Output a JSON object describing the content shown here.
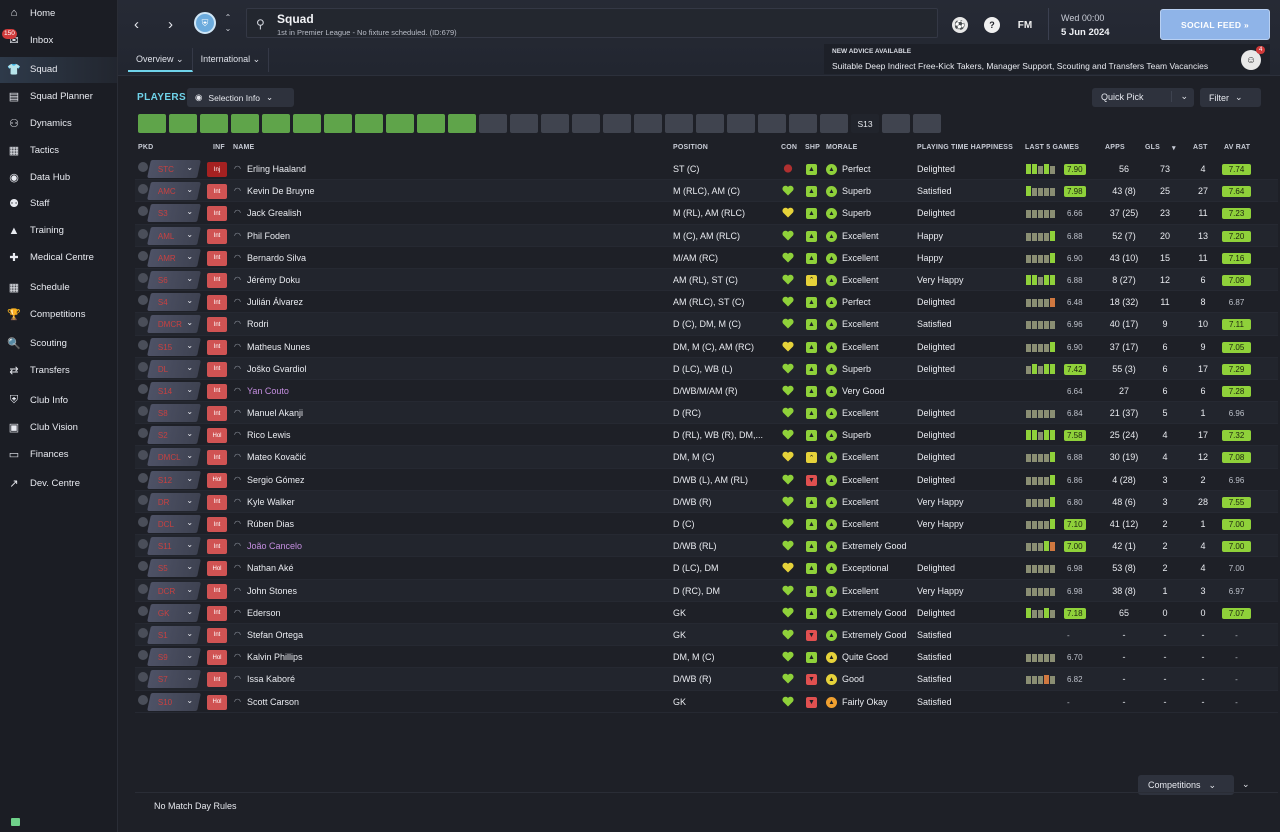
{
  "sidebar": {
    "items": [
      {
        "label": "Home",
        "icon": "home-icon",
        "glyph": "⌂"
      },
      {
        "label": "Inbox",
        "icon": "inbox-icon",
        "glyph": "✉",
        "badge": "150"
      },
      {
        "label": "Squad",
        "icon": "shirt-icon",
        "glyph": "👕",
        "active": true
      },
      {
        "label": "Squad Planner",
        "icon": "clipboard-icon",
        "glyph": "▤"
      },
      {
        "label": "Dynamics",
        "icon": "dynamics-icon",
        "glyph": "⚇"
      },
      {
        "label": "Tactics",
        "icon": "tactics-icon",
        "glyph": "▦"
      },
      {
        "label": "Data Hub",
        "icon": "data-hub-icon",
        "glyph": "◉"
      },
      {
        "label": "Staff",
        "icon": "staff-icon",
        "glyph": "⚉"
      },
      {
        "label": "Training",
        "icon": "training-icon",
        "glyph": "▲"
      },
      {
        "label": "Medical Centre",
        "icon": "medical-icon",
        "glyph": "✚"
      },
      {
        "label": "Schedule",
        "icon": "calendar-icon",
        "glyph": "▦"
      },
      {
        "label": "Competitions",
        "icon": "trophy-icon",
        "glyph": "🏆"
      },
      {
        "label": "Scouting",
        "icon": "magnifier-icon",
        "glyph": "🔍"
      },
      {
        "label": "Transfers",
        "icon": "transfers-icon",
        "glyph": "⇄"
      },
      {
        "label": "Club Info",
        "icon": "shield-icon",
        "glyph": "⛨"
      },
      {
        "label": "Club Vision",
        "icon": "briefcase-icon",
        "glyph": "▣"
      },
      {
        "label": "Finances",
        "icon": "finances-icon",
        "glyph": "▭"
      },
      {
        "label": "Dev. Centre",
        "icon": "dev-centre-icon",
        "glyph": "↗"
      }
    ]
  },
  "header": {
    "title": "Squad",
    "subtitle": "1st in Premier League - No fixture scheduled. (ID:679)",
    "fm_label": "FM",
    "help_label": "?",
    "date_top": "Wed 00:00",
    "date_bottom": "5 Jun 2024",
    "social_label": "SOCIAL FEED  »"
  },
  "tabs": [
    {
      "label": "Overview ⌄"
    },
    {
      "label": "International ⌄"
    }
  ],
  "advice": {
    "heading": "NEW ADVICE AVAILABLE",
    "text": "Suitable Deep Indirect Free-Kick Takers, Manager Support, Scouting and Transfers Team Vacancies",
    "badge": "4"
  },
  "toolbar": {
    "players_label": "PLAYERS",
    "selection_label": "Selection Info",
    "quick_pick_label": "Quick Pick",
    "filter_label": "Filter"
  },
  "position_chips": [
    {
      "label": "GK",
      "state": "g"
    },
    {
      "label": "DR",
      "state": "g"
    },
    {
      "label": "DCR",
      "state": "g"
    },
    {
      "label": "DCL",
      "state": "g"
    },
    {
      "label": "DL",
      "state": "g"
    },
    {
      "label": "DMCR",
      "state": "g"
    },
    {
      "label": "DMCL",
      "state": "g"
    },
    {
      "label": "AMR",
      "state": "g"
    },
    {
      "label": "AMC",
      "state": "g"
    },
    {
      "label": "AML",
      "state": "g"
    },
    {
      "label": "STC",
      "state": "g"
    },
    {
      "label": "S1",
      "state": "x"
    },
    {
      "label": "S2",
      "state": "x"
    },
    {
      "label": "S3",
      "state": "x"
    },
    {
      "label": "S4",
      "state": "x"
    },
    {
      "label": "S5",
      "state": "x"
    },
    {
      "label": "S6",
      "state": "x"
    },
    {
      "label": "S7",
      "state": "x"
    },
    {
      "label": "S8",
      "state": "x"
    },
    {
      "label": "S9",
      "state": "x"
    },
    {
      "label": "S10",
      "state": "x"
    },
    {
      "label": "S11",
      "state": "x"
    },
    {
      "label": "S12",
      "state": "x"
    },
    {
      "label": "S13",
      "state": "s"
    },
    {
      "label": "S14",
      "state": "x"
    },
    {
      "label": "S15",
      "state": "x"
    }
  ],
  "columns": {
    "pkd": "PKD",
    "inf": "INF",
    "name": "NAME",
    "position": "POSITION",
    "con": "CON",
    "shp": "SHP",
    "morale": "MORALE",
    "pth": "PLAYING TIME HAPPINESS",
    "last5": "LAST 5 GAMES",
    "apps": "APPS",
    "gls": "GLS",
    "gls_sort": "▾",
    "ast": "AST",
    "avrat": "AV RAT"
  },
  "players": [
    {
      "role": "STC",
      "inf": "Inj",
      "name": "Erling Haaland",
      "position": "ST (C)",
      "con": "red",
      "shp": "green",
      "morale": "Perfect",
      "mic": "green",
      "pth": "Delighted",
      "last5": [
        "g",
        "g",
        "y",
        "g",
        "y"
      ],
      "lr": "7.90",
      "lrhl": true,
      "apps": "56",
      "gls": "73",
      "ast": "4",
      "avr": "7.74",
      "avrhl": true
    },
    {
      "role": "AMC",
      "inf": "Int",
      "name": "Kevin De Bruyne",
      "position": "M (RLC), AM (C)",
      "con": "green",
      "shp": "green",
      "morale": "Superb",
      "mic": "green",
      "pth": "Satisfied",
      "last5": [
        "g",
        "y",
        "y",
        "y",
        "y"
      ],
      "lr": "7.98",
      "lrhl": true,
      "apps": "43 (8)",
      "gls": "25",
      "ast": "27",
      "avr": "7.64",
      "avrhl": true
    },
    {
      "role": "S3",
      "inf": "Int",
      "name": "Jack Grealish",
      "position": "M (RL), AM (RLC)",
      "con": "yellow",
      "shp": "green",
      "morale": "Superb",
      "mic": "green",
      "pth": "Delighted",
      "last5": [
        "y",
        "y",
        "y",
        "y",
        "y"
      ],
      "lr": "6.66",
      "lrhl": false,
      "apps": "37 (25)",
      "gls": "23",
      "ast": "11",
      "avr": "7.23",
      "avrhl": true
    },
    {
      "role": "AML",
      "inf": "Int",
      "name": "Phil Foden",
      "position": "M (C), AM (RLC)",
      "con": "green",
      "shp": "green",
      "morale": "Excellent",
      "mic": "green",
      "pth": "Happy",
      "last5": [
        "y",
        "y",
        "y",
        "y",
        "g"
      ],
      "lr": "6.88",
      "lrhl": false,
      "apps": "52 (7)",
      "gls": "20",
      "ast": "13",
      "avr": "7.20",
      "avrhl": true
    },
    {
      "role": "AMR",
      "inf": "Int",
      "name": "Bernardo Silva",
      "position": "M/AM (RC)",
      "con": "green",
      "shp": "green",
      "morale": "Excellent",
      "mic": "green",
      "pth": "Happy",
      "last5": [
        "y",
        "y",
        "y",
        "y",
        "g"
      ],
      "lr": "6.90",
      "lrhl": false,
      "apps": "43 (10)",
      "gls": "15",
      "ast": "11",
      "avr": "7.16",
      "avrhl": true
    },
    {
      "role": "S6",
      "inf": "Int",
      "name": "Jérémy Doku",
      "position": "AM (RL), ST (C)",
      "con": "green",
      "shp": "yellow",
      "morale": "Excellent",
      "mic": "green",
      "pth": "Very Happy",
      "last5": [
        "g",
        "g",
        "y",
        "g",
        "g"
      ],
      "lr": "6.88",
      "lrhl": false,
      "apps": "8 (27)",
      "gls": "12",
      "ast": "6",
      "avr": "7.08",
      "avrhl": true
    },
    {
      "role": "S4",
      "inf": "Int",
      "name": "Julián Álvarez",
      "position": "AM (RLC), ST (C)",
      "con": "green",
      "shp": "green",
      "morale": "Perfect",
      "mic": "green",
      "pth": "Delighted",
      "last5": [
        "y",
        "y",
        "y",
        "y",
        "o"
      ],
      "lr": "6.48",
      "lrhl": false,
      "apps": "18 (32)",
      "gls": "11",
      "ast": "8",
      "avr": "6.87",
      "avrhl": false
    },
    {
      "role": "DMCR",
      "inf": "Int",
      "name": "Rodri",
      "position": "D (C), DM, M (C)",
      "con": "green",
      "shp": "green",
      "morale": "Excellent",
      "mic": "green",
      "pth": "Satisfied",
      "last5": [
        "y",
        "y",
        "y",
        "y",
        "y"
      ],
      "lr": "6.96",
      "lrhl": false,
      "apps": "40 (17)",
      "gls": "9",
      "ast": "10",
      "avr": "7.11",
      "avrhl": true
    },
    {
      "role": "S15",
      "inf": "Int",
      "name": "Matheus Nunes",
      "position": "DM, M (C), AM (RC)",
      "con": "yellow",
      "shp": "green",
      "morale": "Excellent",
      "mic": "green",
      "pth": "Delighted",
      "last5": [
        "y",
        "y",
        "y",
        "y",
        "g"
      ],
      "lr": "6.90",
      "lrhl": false,
      "apps": "37 (17)",
      "gls": "6",
      "ast": "9",
      "avr": "7.05",
      "avrhl": true
    },
    {
      "role": "DL",
      "inf": "Int",
      "name": "Joško Gvardiol",
      "position": "D (LC), WB (L)",
      "con": "green",
      "shp": "green",
      "morale": "Superb",
      "mic": "green",
      "pth": "Delighted",
      "last5": [
        "y",
        "g",
        "y",
        "g",
        "g"
      ],
      "lr": "7.42",
      "lrhl": true,
      "apps": "55 (3)",
      "gls": "6",
      "ast": "17",
      "avr": "7.29",
      "avrhl": true
    },
    {
      "role": "S14",
      "inf": "Int",
      "name": "Yan Couto",
      "loan": true,
      "position": "D/WB/M/AM (R)",
      "con": "green",
      "shp": "green",
      "morale": "Very Good",
      "mic": "green",
      "pth": "",
      "last5": [],
      "lr": "6.64",
      "lrhl": false,
      "apps": "27",
      "gls": "6",
      "ast": "6",
      "avr": "7.28",
      "avrhl": true
    },
    {
      "role": "S8",
      "inf": "Int",
      "name": "Manuel Akanji",
      "position": "D (RC)",
      "con": "green",
      "shp": "green",
      "morale": "Excellent",
      "mic": "green",
      "pth": "Delighted",
      "last5": [
        "y",
        "y",
        "y",
        "y",
        "y"
      ],
      "lr": "6.84",
      "lrhl": false,
      "apps": "21 (37)",
      "gls": "5",
      "ast": "1",
      "avr": "6.96",
      "avrhl": false
    },
    {
      "role": "S2",
      "inf": "Hol",
      "name": "Rico Lewis",
      "position": "D (RL), WB (R), DM,...",
      "con": "green",
      "shp": "green",
      "morale": "Superb",
      "mic": "green",
      "pth": "Delighted",
      "last5": [
        "g",
        "g",
        "y",
        "g",
        "g"
      ],
      "lr": "7.58",
      "lrhl": true,
      "apps": "25 (24)",
      "gls": "4",
      "ast": "17",
      "avr": "7.32",
      "avrhl": true
    },
    {
      "role": "DMCL",
      "inf": "Int",
      "name": "Mateo Kovačić",
      "position": "DM, M (C)",
      "con": "yellow",
      "shp": "yellow",
      "morale": "Excellent",
      "mic": "green",
      "pth": "Delighted",
      "last5": [
        "y",
        "y",
        "y",
        "y",
        "g"
      ],
      "lr": "6.88",
      "lrhl": false,
      "apps": "30 (19)",
      "gls": "4",
      "ast": "12",
      "avr": "7.08",
      "avrhl": true
    },
    {
      "role": "S12",
      "inf": "Hol",
      "name": "Sergio Gómez",
      "position": "D/WB (L), AM (RL)",
      "con": "green",
      "shp": "red",
      "morale": "Excellent",
      "mic": "green",
      "pth": "Delighted",
      "last5": [
        "y",
        "y",
        "y",
        "y",
        "g"
      ],
      "lr": "6.86",
      "lrhl": false,
      "apps": "4 (28)",
      "gls": "3",
      "ast": "2",
      "avr": "6.96",
      "avrhl": false
    },
    {
      "role": "DR",
      "inf": "Int",
      "name": "Kyle Walker",
      "position": "D/WB (R)",
      "con": "green",
      "shp": "green",
      "morale": "Excellent",
      "mic": "green",
      "pth": "Very Happy",
      "last5": [
        "y",
        "y",
        "y",
        "y",
        "g"
      ],
      "lr": "6.80",
      "lrhl": false,
      "apps": "48 (6)",
      "gls": "3",
      "ast": "28",
      "avr": "7.55",
      "avrhl": true
    },
    {
      "role": "DCL",
      "inf": "Int",
      "name": "Rúben Dias",
      "position": "D (C)",
      "con": "green",
      "shp": "green",
      "morale": "Excellent",
      "mic": "green",
      "pth": "Very Happy",
      "last5": [
        "y",
        "y",
        "y",
        "y",
        "g"
      ],
      "lr": "7.10",
      "lrhl": true,
      "apps": "41 (12)",
      "gls": "2",
      "ast": "1",
      "avr": "7.00",
      "avrhl": true
    },
    {
      "role": "S11",
      "inf": "Int",
      "name": "João Cancelo",
      "loan": true,
      "position": "D/WB (RL)",
      "con": "green",
      "shp": "green",
      "morale": "Extremely Good",
      "mic": "green",
      "pth": "",
      "last5": [
        "y",
        "y",
        "y",
        "g",
        "o"
      ],
      "lr": "7.00",
      "lrhl": true,
      "apps": "42 (1)",
      "gls": "2",
      "ast": "4",
      "avr": "7.00",
      "avrhl": true
    },
    {
      "role": "S5",
      "inf": "Hol",
      "name": "Nathan Aké",
      "position": "D (LC), DM",
      "con": "yellow",
      "shp": "green",
      "morale": "Exceptional",
      "mic": "green",
      "pth": "Delighted",
      "last5": [
        "y",
        "y",
        "y",
        "y",
        "y"
      ],
      "lr": "6.98",
      "lrhl": false,
      "apps": "53 (8)",
      "gls": "2",
      "ast": "4",
      "avr": "7.00",
      "avrhl": false
    },
    {
      "role": "DCR",
      "inf": "Int",
      "name": "John Stones",
      "position": "D (RC), DM",
      "con": "green",
      "shp": "green",
      "morale": "Excellent",
      "mic": "green",
      "pth": "Very Happy",
      "last5": [
        "y",
        "y",
        "y",
        "y",
        "y"
      ],
      "lr": "6.98",
      "lrhl": false,
      "apps": "38 (8)",
      "gls": "1",
      "ast": "3",
      "avr": "6.97",
      "avrhl": false
    },
    {
      "role": "GK",
      "inf": "Int",
      "name": "Ederson",
      "position": "GK",
      "con": "green",
      "shp": "green",
      "morale": "Extremely Good",
      "mic": "green",
      "pth": "Delighted",
      "last5": [
        "g",
        "y",
        "y",
        "g",
        "y"
      ],
      "lr": "7.18",
      "lrhl": true,
      "apps": "65",
      "gls": "0",
      "ast": "0",
      "avr": "7.07",
      "avrhl": true
    },
    {
      "role": "S1",
      "inf": "Int",
      "name": "Stefan Ortega",
      "position": "GK",
      "con": "green",
      "shp": "red",
      "morale": "Extremely Good",
      "mic": "green",
      "pth": "Satisfied",
      "last5": [],
      "lr": "-",
      "lrhl": false,
      "apps": "-",
      "gls": "-",
      "ast": "-",
      "avr": "-",
      "avrhl": false
    },
    {
      "role": "S9",
      "inf": "Hol",
      "name": "Kalvin Phillips",
      "position": "DM, M (C)",
      "con": "green",
      "shp": "green",
      "morale": "Quite Good",
      "mic": "yellow",
      "pth": "Satisfied",
      "last5": [
        "y",
        "y",
        "y",
        "y",
        "y"
      ],
      "lr": "6.70",
      "lrhl": false,
      "apps": "-",
      "gls": "-",
      "ast": "-",
      "avr": "-",
      "avrhl": false
    },
    {
      "role": "S7",
      "inf": "Int",
      "name": "Issa Kaboré",
      "position": "D/WB (R)",
      "con": "green",
      "shp": "red",
      "morale": "Good",
      "mic": "yellow",
      "pth": "Satisfied",
      "last5": [
        "y",
        "y",
        "y",
        "o",
        "y"
      ],
      "lr": "6.82",
      "lrhl": false,
      "apps": "-",
      "gls": "-",
      "ast": "-",
      "avr": "-",
      "avrhl": false
    },
    {
      "role": "S10",
      "inf": "Hol",
      "name": "Scott Carson",
      "position": "GK",
      "con": "green",
      "shp": "red",
      "morale": "Fairly Okay",
      "mic": "orange",
      "pth": "Satisfied",
      "last5": [],
      "lr": "-",
      "lrhl": false,
      "apps": "-",
      "gls": "-",
      "ast": "-",
      "avr": "-",
      "avrhl": false
    }
  ],
  "footer": {
    "competitions_label": "Competitions",
    "no_match_day": "No Match Day Rules"
  },
  "colors": {
    "accent": "#6fd3ea",
    "green": "#8fd13a",
    "red": "#d05353",
    "social": "#8fb4e8"
  }
}
